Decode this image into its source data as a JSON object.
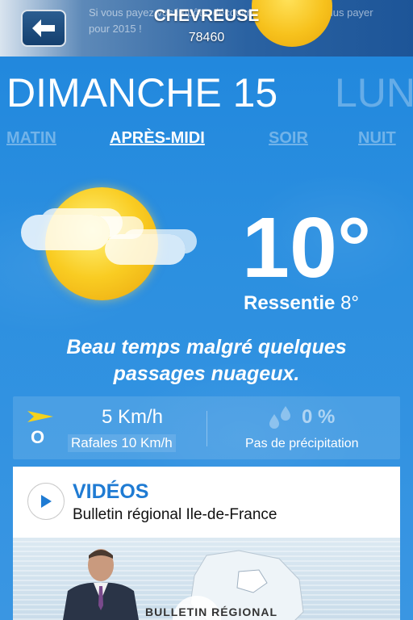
{
  "header": {
    "back_icon": "arrow-left-icon",
    "ad_text": "Si vous payez vos impôts, découvrez comment ne plus payer pour 2015 !",
    "city": "CHEVREUSE",
    "zip": "78460"
  },
  "days": {
    "current": "DIMANCHE 15",
    "next": "LUN"
  },
  "periods": [
    {
      "label": "MATIN",
      "active": false
    },
    {
      "label": "APRÈS-MIDI",
      "active": true
    },
    {
      "label": "SOIR",
      "active": false
    },
    {
      "label": "NUIT",
      "active": false
    }
  ],
  "weather": {
    "icon": "sun-with-clouds-icon",
    "temperature": "10°",
    "feels_label": "Ressentie",
    "feels_value": "8°",
    "summary": "Beau temps malgré quelques passages nuageux."
  },
  "wind": {
    "arrow_icon": "wind-direction-arrow-icon",
    "direction": "O",
    "speed": "5 Km/h",
    "gusts": "Rafales 10 Km/h"
  },
  "rain": {
    "icon": "raindrops-icon",
    "percent": "0 %",
    "label": "Pas de précipitation"
  },
  "videos": {
    "play_icon": "play-icon",
    "title": "VIDÉOS",
    "subtitle": "Bulletin régional Ile-de-France",
    "thumbnail_text": "BULLETIN RÉGIONAL"
  },
  "colors": {
    "sky_blue": "#2b8fe0",
    "accent_blue": "#1f7bd3",
    "sun_yellow": "#f9cc22"
  }
}
